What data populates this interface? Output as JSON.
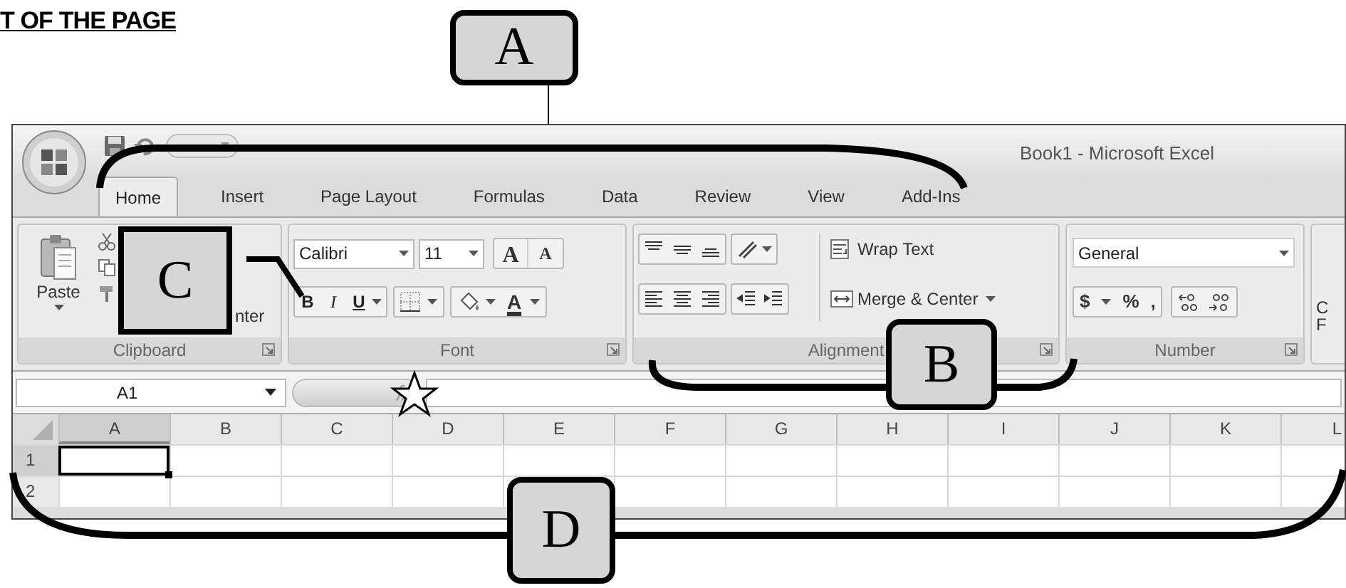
{
  "heading": "T OF THE PAGE",
  "callouts": [
    {
      "label": "A"
    },
    {
      "label": "C"
    },
    {
      "label": "B"
    },
    {
      "label": "D"
    }
  ],
  "window": {
    "title": "Book1 - Microsoft Excel"
  },
  "tabs": [
    {
      "label": "Home",
      "selected": true
    },
    {
      "label": "Insert",
      "selected": false
    },
    {
      "label": "Page Layout",
      "selected": false
    },
    {
      "label": "Formulas",
      "selected": false
    },
    {
      "label": "Data",
      "selected": false
    },
    {
      "label": "Review",
      "selected": false
    },
    {
      "label": "View",
      "selected": false
    },
    {
      "label": "Add-Ins",
      "selected": false
    }
  ],
  "ribbon": {
    "clipboard": {
      "paste": "Paste",
      "format_painter": "nter",
      "label": "Clipboard"
    },
    "font": {
      "font_name": "Calibri",
      "font_size": "11",
      "size_buttons": [
        "A",
        "A"
      ],
      "style_buttons": [
        "B",
        "I",
        "U"
      ],
      "font_color": "A",
      "label": "Font"
    },
    "alignment": {
      "wrap_text": "Wrap Text",
      "merge_center": "Merge & Center",
      "label": "Alignment"
    },
    "number": {
      "format": "General",
      "buttons": [
        "$",
        "%",
        ","
      ],
      "label": "Number"
    },
    "group_5": {
      "lines": [
        "C",
        "F"
      ]
    }
  },
  "formula_bar": {
    "name_box": "A1"
  },
  "sheet": {
    "columns": [
      {
        "label": "A",
        "selected": true
      },
      {
        "label": "B",
        "selected": false
      },
      {
        "label": "C",
        "selected": false
      },
      {
        "label": "D",
        "selected": false
      },
      {
        "label": "E",
        "selected": false
      },
      {
        "label": "F",
        "selected": false
      },
      {
        "label": "G",
        "selected": false
      },
      {
        "label": "H",
        "selected": false
      },
      {
        "label": "I",
        "selected": false
      },
      {
        "label": "J",
        "selected": false
      },
      {
        "label": "K",
        "selected": false
      },
      {
        "label": "L",
        "selected": false
      }
    ],
    "rows": [
      {
        "label": "1",
        "selected": true
      },
      {
        "label": "2",
        "selected": false
      }
    ]
  }
}
